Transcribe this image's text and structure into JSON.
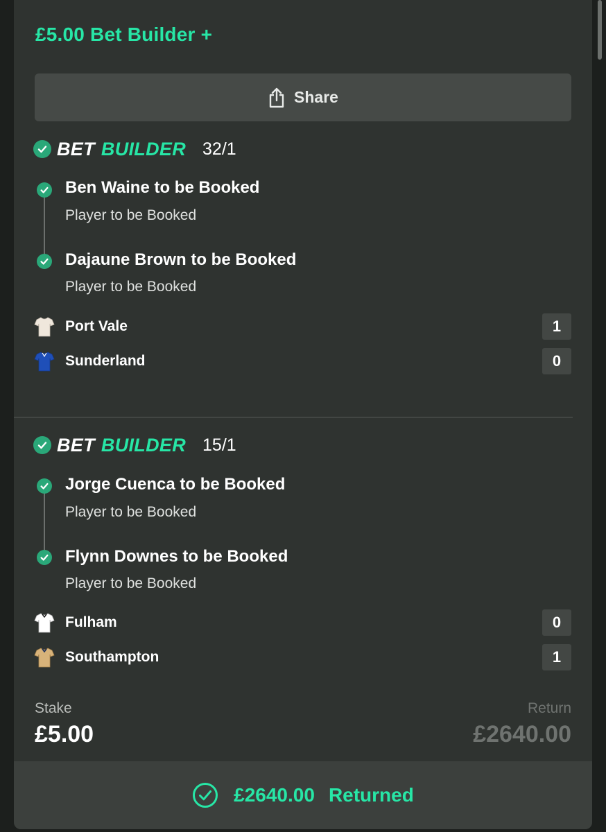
{
  "bet": {
    "title": "£5.00 Bet Builder +",
    "share_label": "Share"
  },
  "sections": [
    {
      "tag_part1": "BET",
      "tag_part2": "BUILDER",
      "odds": "32/1",
      "legs": [
        {
          "title": "Ben Waine to be Booked",
          "market": "Player to be Booked"
        },
        {
          "title": "Dajaune Brown to be Booked",
          "market": "Player to be Booked"
        }
      ],
      "teams": [
        {
          "name": "Port Vale",
          "score": "1",
          "kit_color": "#efe7dc"
        },
        {
          "name": "Sunderland",
          "score": "0",
          "kit_color": "#1f4fb8"
        }
      ]
    },
    {
      "tag_part1": "BET",
      "tag_part2": "BUILDER",
      "odds": "15/1",
      "legs": [
        {
          "title": "Jorge Cuenca to be Booked",
          "market": "Player to be Booked"
        },
        {
          "title": "Flynn Downes to be Booked",
          "market": "Player to be Booked"
        }
      ],
      "teams": [
        {
          "name": "Fulham",
          "score": "0",
          "kit_color": "#ffffff"
        },
        {
          "name": "Southampton",
          "score": "1",
          "kit_color": "#d8b37a"
        }
      ]
    }
  ],
  "summary": {
    "stake_label": "Stake",
    "stake_value": "£5.00",
    "return_label": "Return",
    "return_value": "£2640.00"
  },
  "result": {
    "amount": "£2640.00",
    "status": "Returned"
  },
  "colors": {
    "accent": "#27e6a6",
    "check": "#2aa879",
    "card": "#2f3330"
  }
}
